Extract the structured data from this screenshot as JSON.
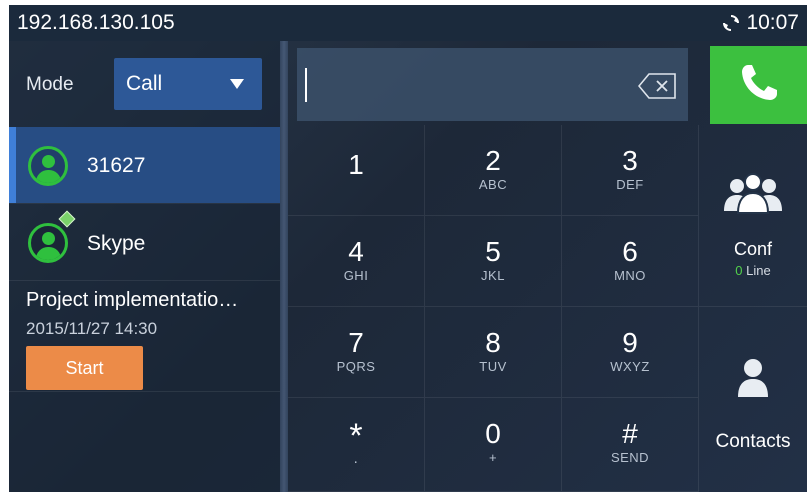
{
  "status_bar": {
    "ip_address": "192.168.130.105",
    "time": "10:07",
    "sync_icon": "sync-icon"
  },
  "left_panel": {
    "mode_label": "Mode",
    "mode_value": "Call",
    "accounts": [
      {
        "name": "31627",
        "icon": "account-avatar-icon",
        "selected": true
      },
      {
        "name": "Skype",
        "icon": "account-avatar-icon",
        "badge": "skype-badge-icon"
      }
    ],
    "meeting": {
      "title": "Project implementatio…",
      "datetime": "2015/11/27 14:30",
      "start_label": "Start"
    }
  },
  "dialer": {
    "input_value": "",
    "backspace_icon": "backspace-icon",
    "call_icon": "phone-icon",
    "keys": [
      {
        "digit": "1",
        "letters": ""
      },
      {
        "digit": "2",
        "letters": "ABC"
      },
      {
        "digit": "3",
        "letters": "DEF"
      },
      {
        "digit": "4",
        "letters": "GHI"
      },
      {
        "digit": "5",
        "letters": "JKL"
      },
      {
        "digit": "6",
        "letters": "MNO"
      },
      {
        "digit": "7",
        "letters": "PQRS"
      },
      {
        "digit": "8",
        "letters": "TUV"
      },
      {
        "digit": "9",
        "letters": "WXYZ"
      },
      {
        "digit": "*",
        "letters": "."
      },
      {
        "digit": "0",
        "letters": "+"
      },
      {
        "digit": "#",
        "letters": "SEND"
      }
    ],
    "conf": {
      "label": "Conf",
      "line_count": "0",
      "line_label": " Line"
    },
    "contacts": {
      "label": "Contacts"
    }
  },
  "colors": {
    "call_green": "#3cc03f",
    "start_orange": "#ec8b48",
    "selected_blue": "#274d84",
    "mode_blue": "#2d5897"
  }
}
